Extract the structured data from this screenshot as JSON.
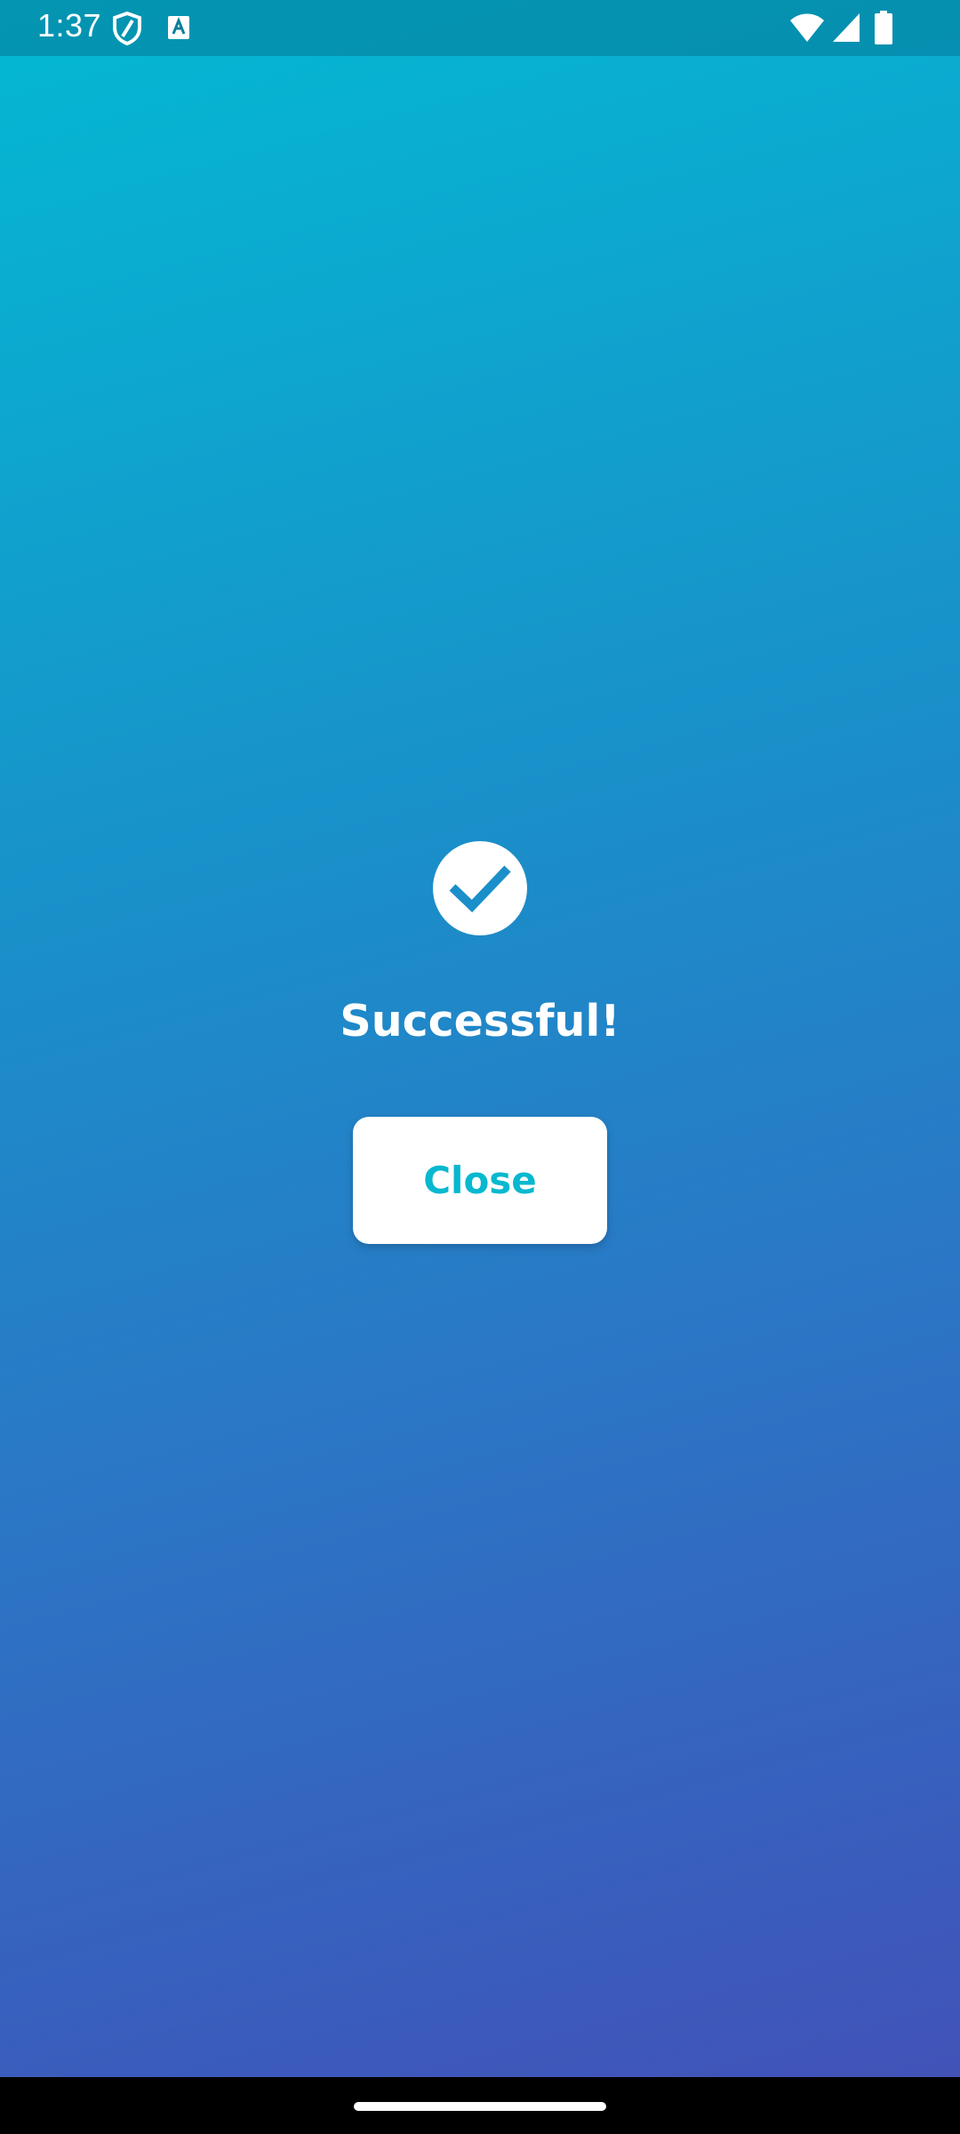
{
  "status_bar": {
    "time": "1:37",
    "icons": [
      "shield-icon",
      "font-a-icon",
      "wifi-icon",
      "cellular-signal-icon",
      "battery-icon"
    ]
  },
  "dialog": {
    "icon": "check-circle-icon",
    "title": "Successful!",
    "close_label": "Close"
  },
  "colors": {
    "gradient_top": "#03b9d3",
    "gradient_bottom": "#4450b7",
    "button_text": "#08b8cf",
    "button_bg": "#ffffff",
    "check_stroke": "#1a8fc9"
  }
}
